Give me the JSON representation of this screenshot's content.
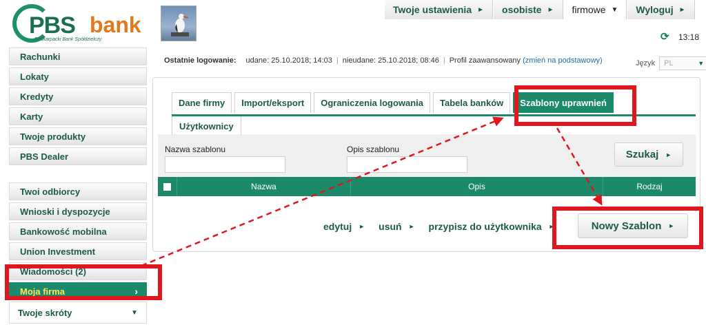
{
  "logo": {
    "name": "PBS",
    "suffix": "bank",
    "subtitle": "Podkarpacki Bank Spółdzielczy"
  },
  "topnav": [
    {
      "label": "Twoje ustawienia",
      "arrow": "►"
    },
    {
      "label": "osobiste",
      "arrow": "►"
    },
    {
      "label": "firmowe",
      "arrow": "▼"
    },
    {
      "label": "Wyloguj",
      "arrow": "►"
    }
  ],
  "clock": {
    "time": "13:18",
    "icon": "refresh-icon"
  },
  "sidebar": {
    "items": [
      {
        "label": "Rachunki"
      },
      {
        "label": "Lokaty"
      },
      {
        "label": "Kredyty"
      },
      {
        "label": "Karty"
      },
      {
        "label": "Twoje produkty"
      },
      {
        "label": "PBS Dealer"
      }
    ],
    "items2": [
      {
        "label": "Twoi odbiorcy"
      },
      {
        "label": "Wnioski i dyspozycje"
      },
      {
        "label": "Bankowość mobilna"
      },
      {
        "label": "Union Investment"
      },
      {
        "label": "Wiadomości (2)"
      }
    ],
    "active": {
      "label": "Moja firma",
      "chevron": "›"
    },
    "shortcuts": {
      "label": "Twoje skróty",
      "arrow": "▼"
    }
  },
  "login": {
    "label": "Ostatnie logowanie:",
    "success": "udane: 25.10.2018; 14:03",
    "failed": "nieudane: 25.10.2018; 08:46",
    "profile": "Profil zaawansowany",
    "change_link": "(zmień na podstawowy)"
  },
  "language": {
    "label": "Język",
    "value": "PL",
    "arrow": "▼"
  },
  "tabs": [
    {
      "label": "Dane firmy"
    },
    {
      "label": "Import/eksport"
    },
    {
      "label": "Ograniczenia logowania"
    },
    {
      "label": "Tabela banków"
    },
    {
      "label": "Szablony uprawnień"
    }
  ],
  "tabs_row2": [
    {
      "label": "Użytkownicy"
    }
  ],
  "filter": {
    "name_label": "Nazwa szablonu",
    "name_value": "",
    "desc_label": "Opis szablonu",
    "desc_value": "",
    "search_label": "Szukaj",
    "search_arrow": "►"
  },
  "table": {
    "columns": [
      "Nazwa",
      "Opis",
      "Rodzaj"
    ]
  },
  "actions": [
    {
      "label": "edytuj",
      "arrow": "►"
    },
    {
      "label": "usuń",
      "arrow": "►"
    },
    {
      "label": "przypisz do użytkownika",
      "arrow": "►"
    }
  ],
  "new_button": {
    "label": "Nowy Szablon",
    "arrow": "►"
  },
  "colors": {
    "brand": "#1c8a6a",
    "brand_dark": "#1c5a47",
    "logo_orange": "#e07a1d",
    "highlight": "#e0161e"
  }
}
